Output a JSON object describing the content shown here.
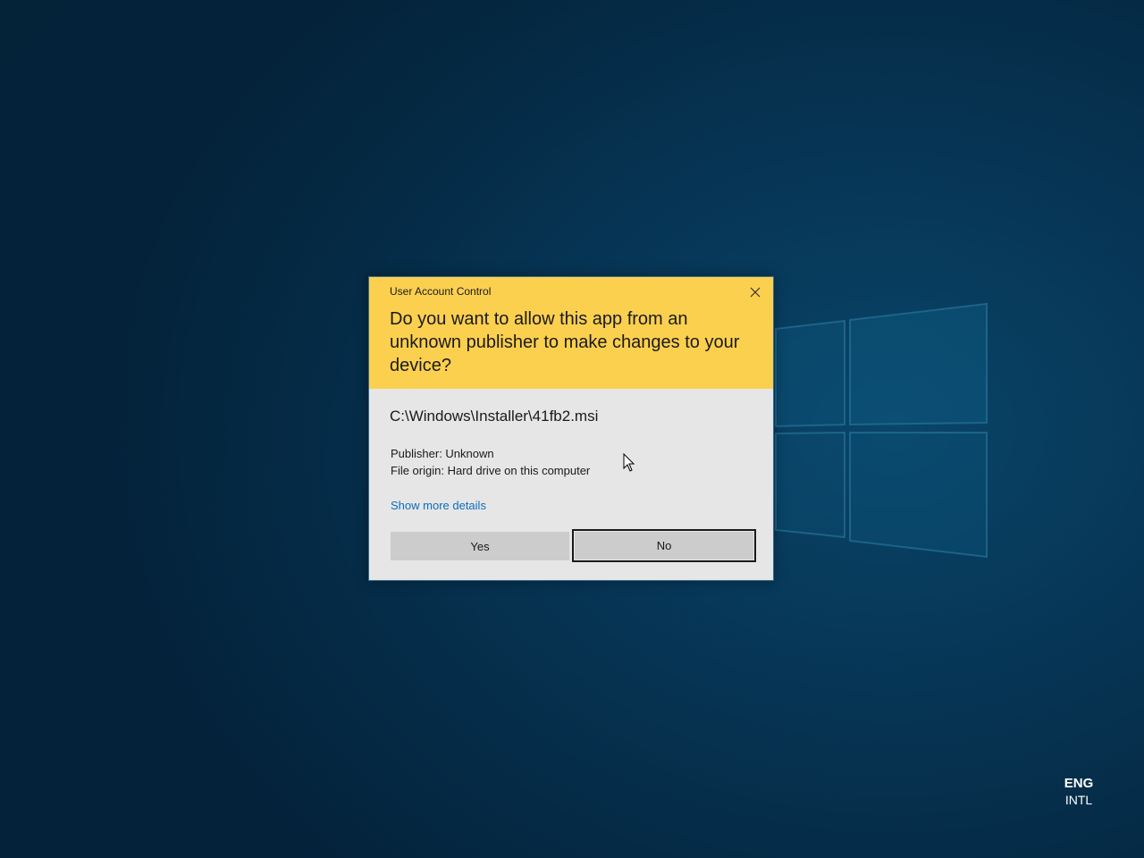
{
  "dialog": {
    "title": "User Account Control",
    "question": "Do you want to allow this app from an unknown publisher to make changes to your device?",
    "file_path": "C:\\Windows\\Installer\\41fb2.msi",
    "publisher": "Publisher: Unknown",
    "file_origin": "File origin: Hard drive on this computer",
    "details_link": "Show more details",
    "yes_label": "Yes",
    "no_label": "No",
    "header_color": "#fcd04f",
    "body_color": "#e6e6e6",
    "link_color": "#0a6ebd",
    "close_icon": "close-icon"
  },
  "system_tray": {
    "language": "ENG",
    "layout": "INTL"
  },
  "desktop": {
    "background_color": "#073a5c",
    "logo": "windows-logo"
  }
}
